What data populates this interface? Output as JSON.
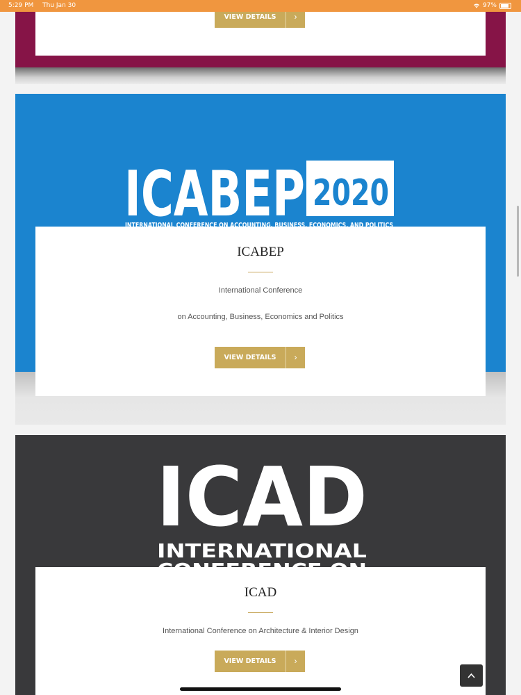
{
  "status_bar": {
    "time": "5:29 PM",
    "date": "Thu Jan 30",
    "battery": "97%"
  },
  "cards": [
    {
      "button_label": "VIEW DETAILS",
      "frame_color": "#861447"
    },
    {
      "logo_main": "ICABEP",
      "logo_year": "2020",
      "logo_tagline": "INTERNATIONAL CONFERENCE ON ACCOUNTING, BUSINESS, ECONOMICS, AND POLITICS",
      "title": "ICABEP",
      "desc_line1": "International Conference",
      "desc_line2": "on Accounting, Business, Economics and Politics",
      "button_label": "VIEW DETAILS",
      "banner_color": "#1b84cf"
    },
    {
      "logo_main": "ICAD",
      "logo_line2": "INTERNATIONAL",
      "logo_line3": "CONFERENCE ON",
      "title": "ICAD",
      "desc_line1": "International Conference on Architecture & Interior Design",
      "button_label": "VIEW DETAILS",
      "banner_color": "#39393b"
    }
  ],
  "accent_color": "#c9aa5a",
  "icons": {
    "button_arrow": "chevron-right-icon",
    "scroll_top": "chevron-up-icon"
  }
}
